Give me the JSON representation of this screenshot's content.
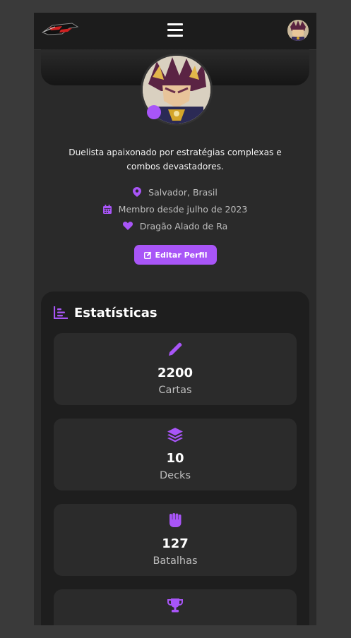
{
  "colors": {
    "accent": "#a855f7",
    "background": "#2a2a2a",
    "card": "#2b2b2b",
    "panel": "#1e1e1e"
  },
  "header": {
    "logo_icon": "duel-disk-logo",
    "menu_icon": "hamburger-icon",
    "avatar_icon": "user-avatar"
  },
  "profile": {
    "bio_line1": "Duelista apaixonado por estratégias complexas e",
    "bio_line2": "combos devastadores.",
    "location": "Salvador, Brasil",
    "member_since": "Membro desde julho de 2023",
    "favorite_card": "Dragão Alado de Ra",
    "edit_button": "Editar Perfil"
  },
  "stats": {
    "title": "Estatísticas",
    "items": [
      {
        "icon": "pencil-icon",
        "value": "2200",
        "label": "Cartas"
      },
      {
        "icon": "layers-icon",
        "value": "10",
        "label": "Decks"
      },
      {
        "icon": "fist-icon",
        "value": "127",
        "label": "Batalhas"
      },
      {
        "icon": "trophy-icon",
        "value": "",
        "label": ""
      }
    ]
  }
}
